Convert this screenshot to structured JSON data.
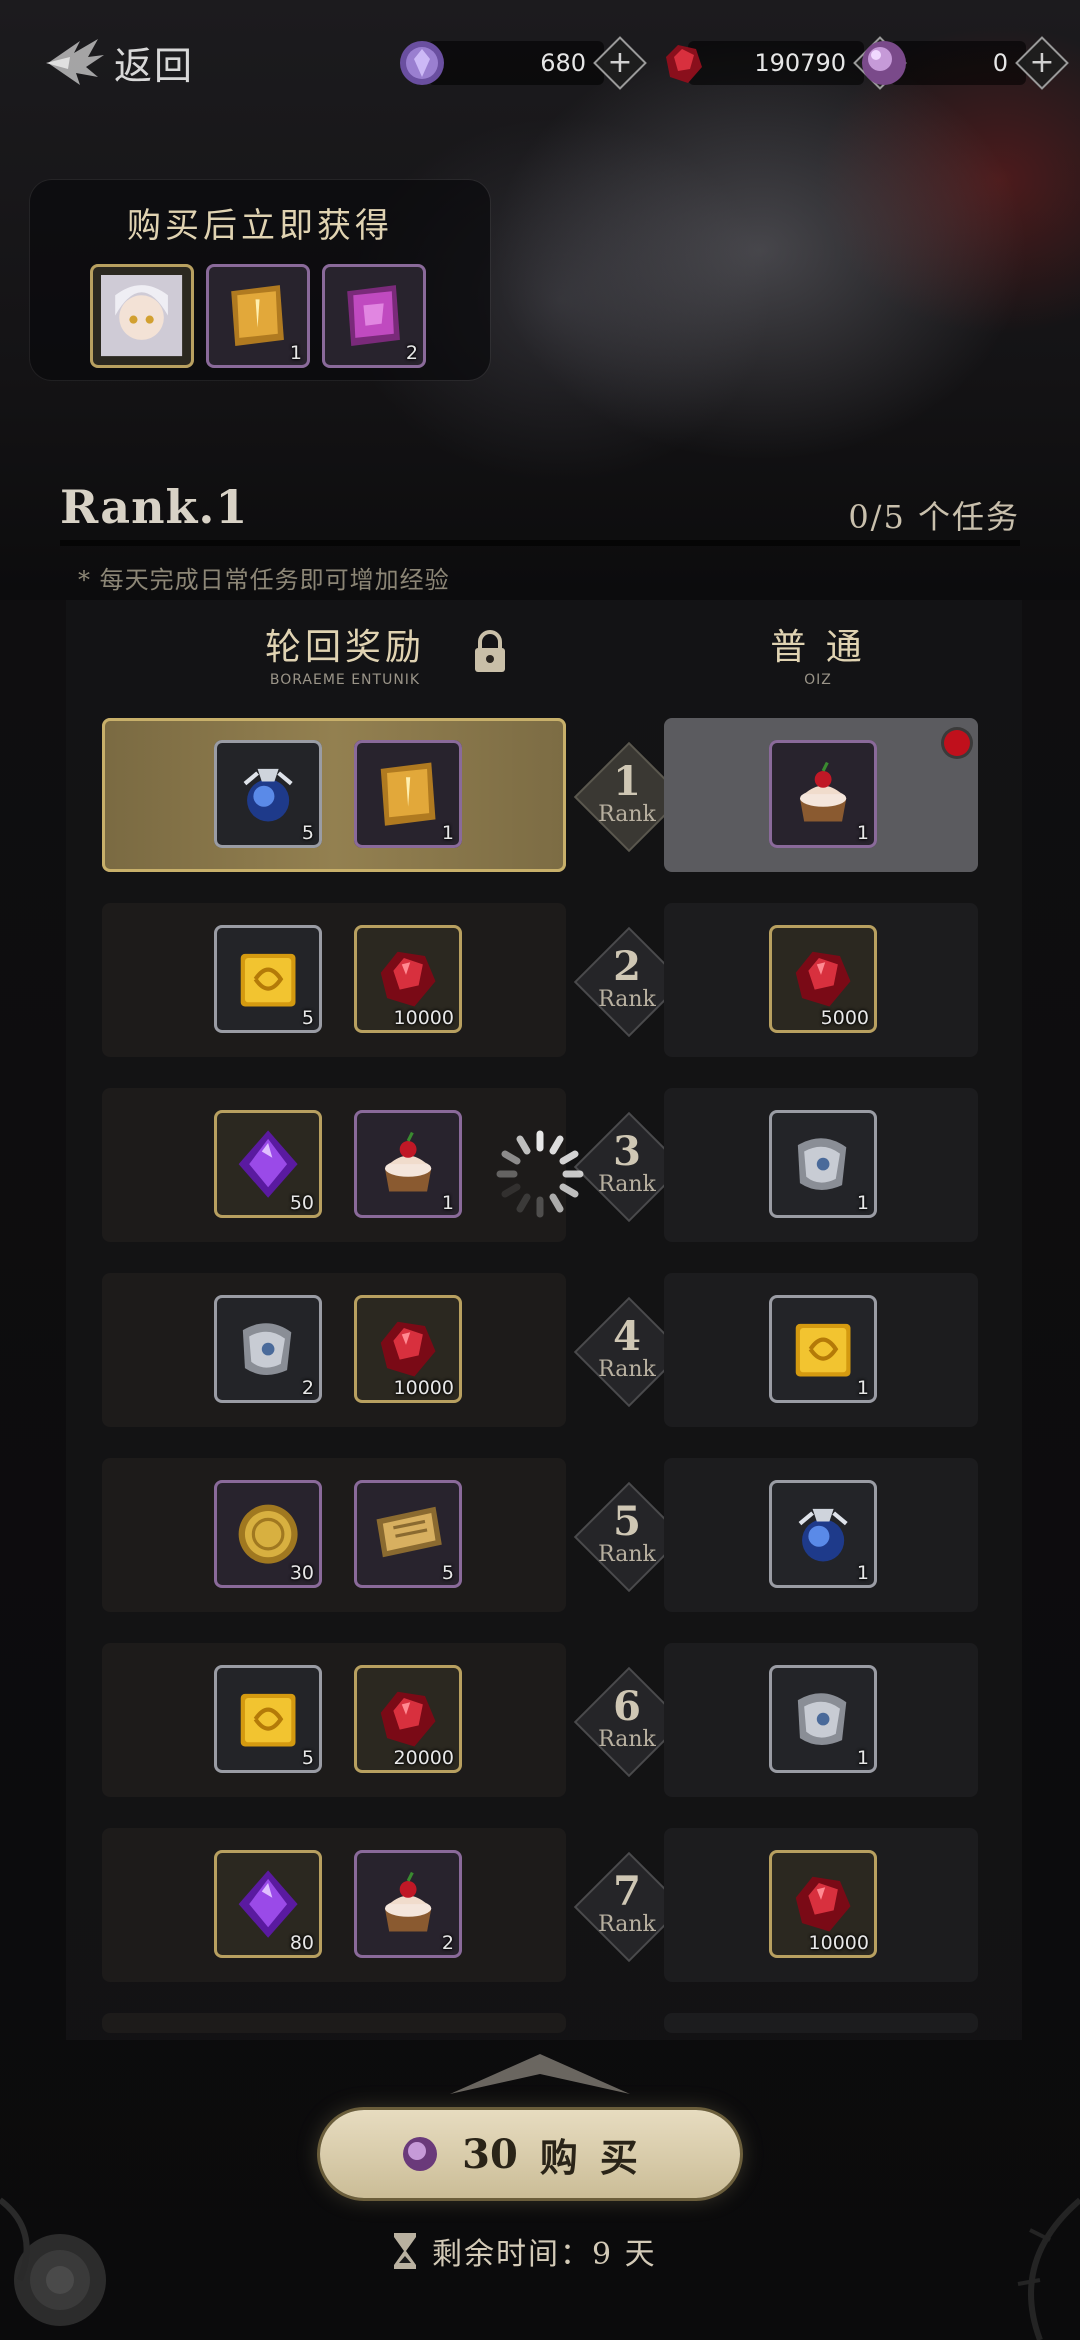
{
  "header": {
    "back_label": "返回",
    "currencies": [
      {
        "icon": "purple-crystal-icon",
        "value": "680"
      },
      {
        "icon": "red-gem-icon",
        "value": "190790"
      },
      {
        "icon": "pink-orb-icon",
        "value": "0"
      }
    ]
  },
  "instant": {
    "title": "购买后立即获得",
    "items": [
      {
        "icon": "character-portrait-icon",
        "count": ""
      },
      {
        "icon": "gold-scroll-icon",
        "count": "1"
      },
      {
        "icon": "purple-scroll-icon",
        "count": "2"
      }
    ]
  },
  "rank": {
    "title": "Rank.1",
    "progress": "0/5 个任务",
    "hint": "* 每天完成日常任务即可增加经验"
  },
  "columns": {
    "premium_title": "轮回奖励",
    "premium_sub": "BORAEME ENTUNIK",
    "normal_title": "普 通",
    "normal_sub": "OIZ"
  },
  "rank_label": "Rank",
  "rows": [
    {
      "rank": "1",
      "premium": [
        {
          "icon": "blue-potion-icon",
          "count": "5"
        },
        {
          "icon": "gold-scroll-icon",
          "count": "1"
        }
      ],
      "normal": [
        {
          "icon": "cake-icon",
          "count": "1"
        }
      ],
      "active": true,
      "notify": true
    },
    {
      "rank": "2",
      "premium": [
        {
          "icon": "gold-cube-icon",
          "count": "5"
        },
        {
          "icon": "red-gem-icon",
          "count": "10000"
        }
      ],
      "normal": [
        {
          "icon": "red-gem-icon",
          "count": "5000"
        }
      ]
    },
    {
      "rank": "3",
      "premium": [
        {
          "icon": "purple-crystal-icon",
          "count": "50"
        },
        {
          "icon": "cake-icon",
          "count": "1"
        }
      ],
      "normal": [
        {
          "icon": "silver-scroll-icon",
          "count": "1"
        }
      ]
    },
    {
      "rank": "4",
      "premium": [
        {
          "icon": "silver-scroll-icon",
          "count": "2"
        },
        {
          "icon": "red-gem-icon",
          "count": "10000"
        }
      ],
      "normal": [
        {
          "icon": "gold-cube-icon",
          "count": "1"
        }
      ]
    },
    {
      "rank": "5",
      "premium": [
        {
          "icon": "gold-coin-icon",
          "count": "30"
        },
        {
          "icon": "ticket-icon",
          "count": "5"
        }
      ],
      "normal": [
        {
          "icon": "blue-potion-icon",
          "count": "1"
        }
      ]
    },
    {
      "rank": "6",
      "premium": [
        {
          "icon": "gold-cube-icon",
          "count": "5"
        },
        {
          "icon": "red-gem-icon",
          "count": "20000"
        }
      ],
      "normal": [
        {
          "icon": "silver-scroll-icon",
          "count": "1"
        }
      ]
    },
    {
      "rank": "7",
      "premium": [
        {
          "icon": "purple-crystal-icon",
          "count": "80"
        },
        {
          "icon": "cake-icon",
          "count": "2"
        }
      ],
      "normal": [
        {
          "icon": "red-gem-icon",
          "count": "10000"
        }
      ]
    }
  ],
  "buy": {
    "price": "30",
    "label": "购买"
  },
  "remaining": "剩余时间：9 天"
}
